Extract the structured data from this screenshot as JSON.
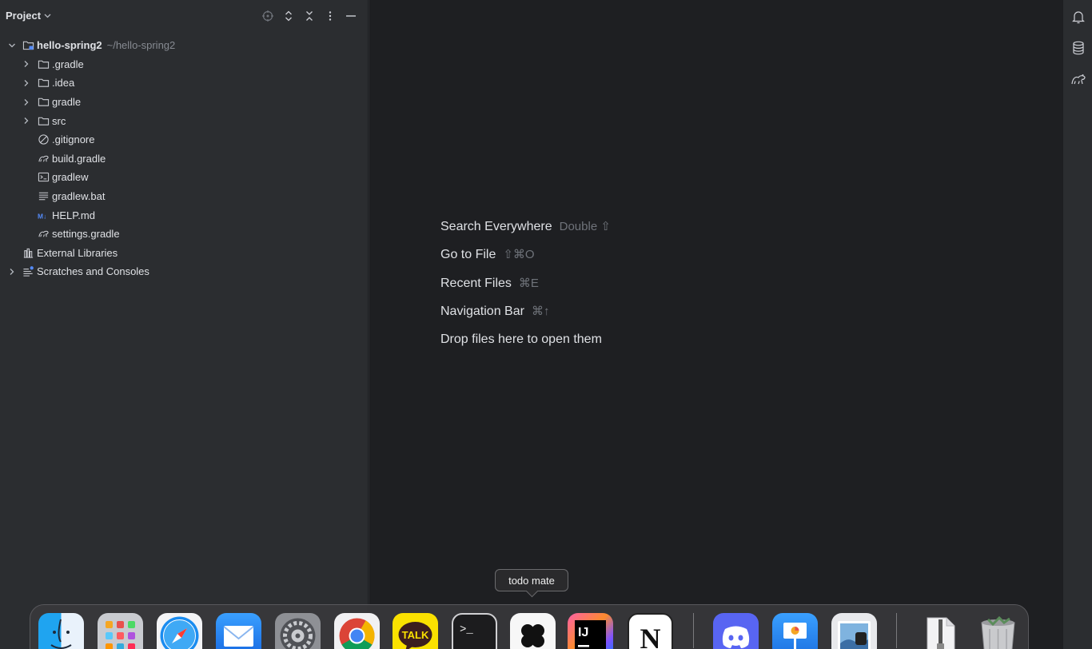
{
  "project_panel": {
    "title": "Project",
    "header_icons": [
      "locate-icon",
      "expand-icon",
      "collapse-icon",
      "more-icon",
      "minimize-icon"
    ],
    "tree": [
      {
        "label": "hello-spring2",
        "path": "~/hello-spring2",
        "type": "module",
        "expanded": true,
        "bold": true
      },
      {
        "label": ".gradle",
        "type": "folder"
      },
      {
        "label": ".idea",
        "type": "folder"
      },
      {
        "label": "gradle",
        "type": "folder"
      },
      {
        "label": "src",
        "type": "folder"
      },
      {
        "label": ".gitignore",
        "type": "ignore-file"
      },
      {
        "label": "build.gradle",
        "type": "gradle-file"
      },
      {
        "label": "gradlew",
        "type": "shell-file"
      },
      {
        "label": "gradlew.bat",
        "type": "text-file"
      },
      {
        "label": "HELP.md",
        "type": "markdown-file"
      },
      {
        "label": "settings.gradle",
        "type": "gradle-file"
      },
      {
        "label": "External Libraries",
        "type": "libraries"
      },
      {
        "label": "Scratches and Consoles",
        "type": "scratches"
      }
    ]
  },
  "editor": {
    "hints": [
      {
        "label": "Search Everywhere",
        "shortcut": "Double ⇧"
      },
      {
        "label": "Go to File",
        "shortcut": "⇧⌘O"
      },
      {
        "label": "Recent Files",
        "shortcut": "⌘E"
      },
      {
        "label": "Navigation Bar",
        "shortcut": "⌘↑"
      },
      {
        "label": "Drop files here to open them",
        "shortcut": ""
      }
    ]
  },
  "right_strip": {
    "icons": [
      "notifications-icon",
      "database-icon",
      "gradle-icon"
    ]
  },
  "dock": {
    "tooltip": "todo mate",
    "apps": [
      {
        "name": "finder",
        "icon": "finder-icon"
      },
      {
        "name": "launchpad",
        "icon": "launchpad-icon"
      },
      {
        "name": "safari",
        "icon": "safari-icon"
      },
      {
        "name": "mail",
        "icon": "mail-icon"
      },
      {
        "name": "system-settings",
        "icon": "settings-gear-icon"
      },
      {
        "name": "chrome",
        "icon": "chrome-icon"
      },
      {
        "name": "kakaotalk",
        "icon": "kakaotalk-icon",
        "text": "TALK"
      },
      {
        "name": "terminal",
        "icon": "terminal-icon",
        "text": ">_"
      },
      {
        "name": "todo-mate",
        "icon": "todo-mate-icon"
      },
      {
        "name": "intellij-idea",
        "icon": "intellij-icon",
        "text": "IJ"
      },
      {
        "name": "notion",
        "icon": "notion-icon",
        "text": "N"
      },
      {
        "name": "discord",
        "icon": "discord-icon"
      },
      {
        "name": "keynote",
        "icon": "keynote-icon"
      },
      {
        "name": "preview",
        "icon": "preview-icon"
      },
      {
        "name": "downloads",
        "icon": "zip-file-icon"
      },
      {
        "name": "trash",
        "icon": "trash-icon"
      }
    ]
  }
}
